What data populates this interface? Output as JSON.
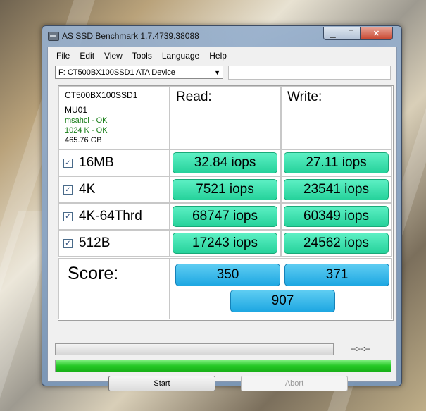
{
  "window": {
    "title": "AS SSD Benchmark 1.7.4739.38088",
    "controls": {
      "minimize": "▁",
      "maximize": "□",
      "close": "✕"
    }
  },
  "menu": [
    "File",
    "Edit",
    "View",
    "Tools",
    "Language",
    "Help"
  ],
  "drive": {
    "selected": "F: CT500BX100SSD1 ATA Device",
    "field_value": ""
  },
  "info": {
    "model": "CT500BX100SSD1",
    "firmware": "MU01",
    "driver": "msahci - OK",
    "alignment": "1024 K - OK",
    "capacity": "465.76 GB"
  },
  "headers": {
    "read": "Read:",
    "write": "Write:"
  },
  "rows": [
    {
      "label": "16MB",
      "checked": true,
      "read": "32.84 iops",
      "write": "27.11 iops"
    },
    {
      "label": "4K",
      "checked": true,
      "read": "7521 iops",
      "write": "23541 iops"
    },
    {
      "label": "4K-64Thrd",
      "checked": true,
      "read": "68747 iops",
      "write": "60349 iops"
    },
    {
      "label": "512B",
      "checked": true,
      "read": "17243 iops",
      "write": "24562 iops"
    }
  ],
  "score": {
    "label": "Score:",
    "read": "350",
    "write": "371",
    "total": "907"
  },
  "progress": {
    "time": "--:--:--",
    "total_fraction": 1.0
  },
  "buttons": {
    "start": "Start",
    "abort": "Abort"
  },
  "colors": {
    "result_green": "#26d29b",
    "score_blue": "#1ea7e2",
    "ok_text": "#167c16"
  }
}
